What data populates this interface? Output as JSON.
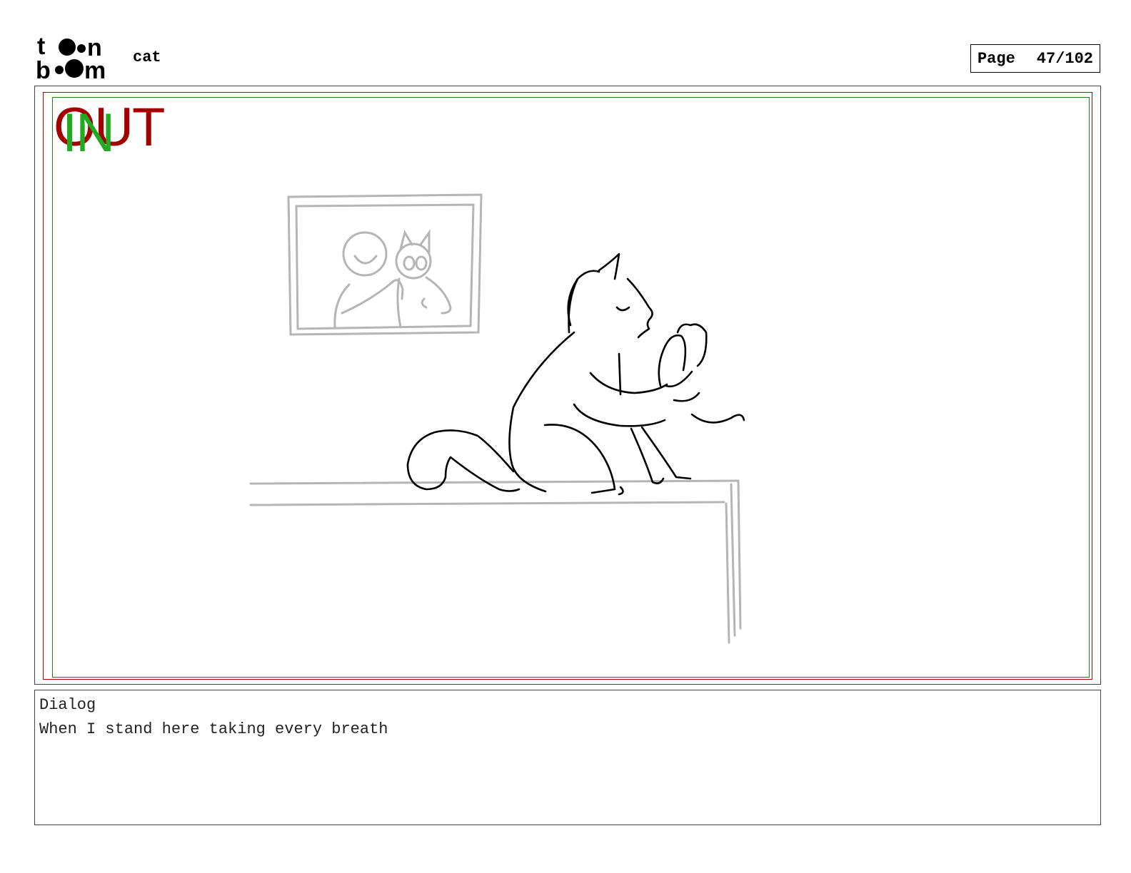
{
  "header": {
    "logo_text": "toon boom",
    "project_title": "cat",
    "page_label": "Page",
    "page_number": "47/102"
  },
  "panel": {
    "out_label": "OUT",
    "in_label": "IN",
    "frame_colors": {
      "out": "#b00000",
      "in": "#1b7d1b"
    }
  },
  "dialog": {
    "title": "Dialog",
    "text": "When I stand here taking every breath"
  }
}
